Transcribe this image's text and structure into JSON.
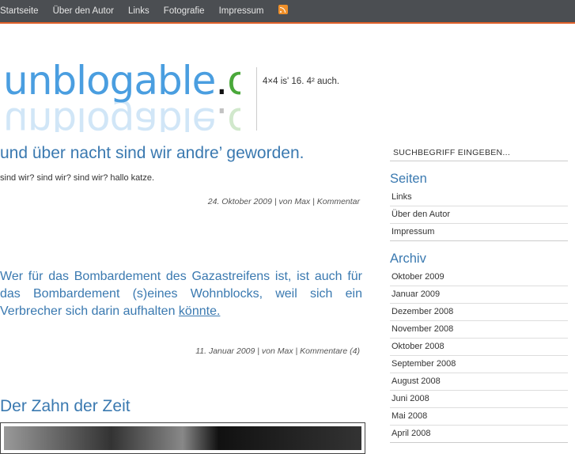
{
  "nav": {
    "items": [
      "Startseite",
      "Über den Autor",
      "Links",
      "Fotografie",
      "Impressum"
    ]
  },
  "logo": {
    "part1": "unblogable",
    "dot": ".",
    "part2": "org"
  },
  "tagline": "4×4 is' 16. 4² auch.",
  "posts": [
    {
      "title": "und über nacht sind wir andre’ geworden.",
      "body": "sind wir? sind wir? sind wir? hallo katze.",
      "meta": "24. Oktober 2009 | von Max | Kommentar"
    },
    {
      "body": "Wer für das Bombardement des Gazastreifens ist, ist auch für das Bombardement (s)eines Wohnblocks, weil sich ein Verbrecher sich darin aufhalten",
      "link": "könnte.",
      "meta": "11. Januar 2009 | von Max | Kommentare (4)"
    },
    {
      "title": "Der Zahn der Zeit"
    }
  ],
  "sidebar": {
    "search_placeholder": "SUCHBEGRIFF EINGEBEN...",
    "pages_title": "Seiten",
    "pages": [
      "Links",
      "Über den Autor",
      "Impressum"
    ],
    "archive_title": "Archiv",
    "archive": [
      "Oktober 2009",
      "Januar 2009",
      "Dezember 2008",
      "November 2008",
      "Oktober 2008",
      "September 2008",
      "August 2008",
      "Juni 2008",
      "Mai 2008",
      "April 2008"
    ]
  }
}
